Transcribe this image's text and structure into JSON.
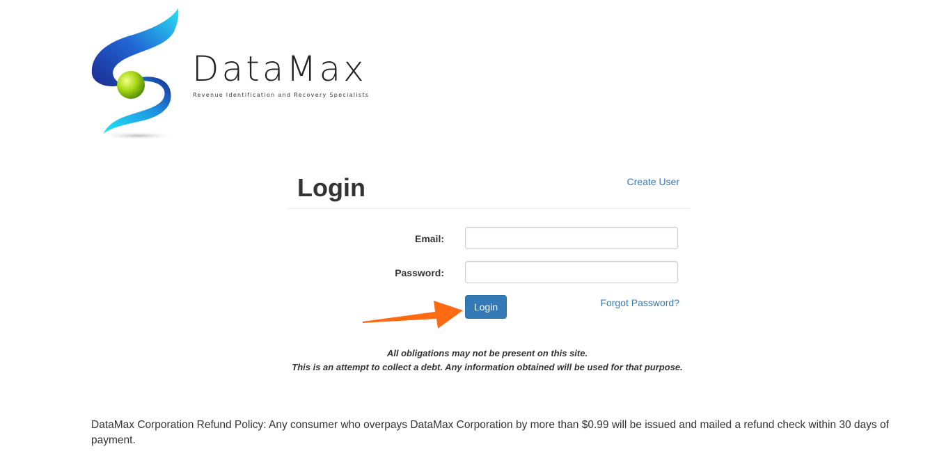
{
  "brand": {
    "name": "DataMax",
    "tagline": "Revenue Identification and Recovery Specialists"
  },
  "login": {
    "heading": "Login",
    "create_user_link": "Create User",
    "email_label": "Email:",
    "email_value": "",
    "password_label": "Password:",
    "password_value": "",
    "submit_label": "Login",
    "forgot_password_link": "Forgot Password?"
  },
  "disclaimers": [
    "All obligations may not be present on this site.",
    "This is an attempt to collect a debt. Any information obtained will be used for that purpose."
  ],
  "refund_policy": "DataMax Corporation Refund Policy: Any consumer who overpays DataMax Corporation by more than $0.99 will be issued and mailed a refund check within 30 days of payment.",
  "colors": {
    "link": "#337ab7",
    "primary_button": "#337ab7",
    "annotation_arrow": "#ff6a13",
    "logo_blue": "#1f3fae",
    "logo_cyan": "#1fd6ef",
    "logo_ball": "#9ad10c"
  },
  "icons": {
    "logo": "datamax-swirl-logo",
    "annotation": "orange-arrow-pointer"
  }
}
